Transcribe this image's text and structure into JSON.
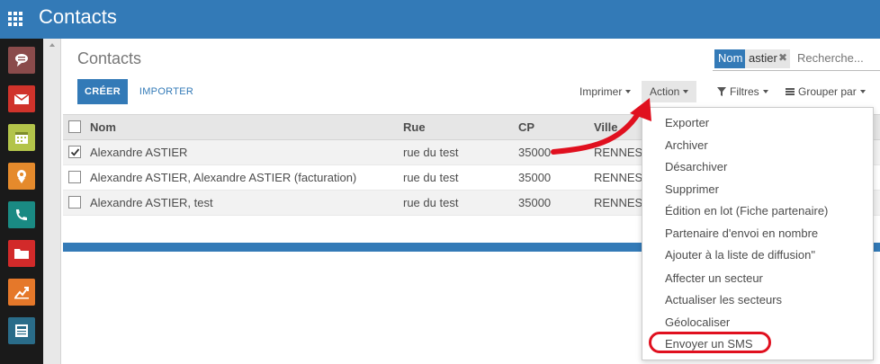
{
  "app": {
    "title": "Contacts"
  },
  "sidebar": {
    "apps": [
      {
        "icon": "chat-icon",
        "color": "#8a4b4b"
      },
      {
        "icon": "mail-icon",
        "color": "#d0332b"
      },
      {
        "icon": "calendar-icon",
        "color": "#b3c44a"
      },
      {
        "icon": "contacts-icon",
        "color": "#e58a2c"
      },
      {
        "icon": "phone-icon",
        "color": "#1a8a83"
      },
      {
        "icon": "folder-icon",
        "color": "#d22a2a"
      },
      {
        "icon": "chart-icon",
        "color": "#e5782a"
      },
      {
        "icon": "news-icon",
        "color": "#2a6c89"
      }
    ]
  },
  "breadcrumb": "Contacts",
  "search": {
    "facet_label": "Nom",
    "facet_value": "astier",
    "placeholder": "Recherche..."
  },
  "buttons": {
    "create": "CRÉER",
    "import": "IMPORTER"
  },
  "toolbar": {
    "print": "Imprimer",
    "action": "Action",
    "filters": "Filtres",
    "group_by": "Grouper par"
  },
  "table": {
    "columns": [
      "Nom",
      "Rue",
      "CP",
      "Ville"
    ],
    "rows": [
      {
        "checked": true,
        "name": "Alexandre ASTIER",
        "street": "rue du test",
        "zip": "35000",
        "city": "RENNES"
      },
      {
        "checked": false,
        "name": "Alexandre ASTIER, Alexandre ASTIER (facturation)",
        "street": "rue du test",
        "zip": "35000",
        "city": "RENNES"
      },
      {
        "checked": false,
        "name": "Alexandre ASTIER, test",
        "street": "rue du test",
        "zip": "35000",
        "city": "RENNES"
      }
    ]
  },
  "action_menu": {
    "items": [
      "Exporter",
      "Archiver",
      "Désarchiver",
      "Supprimer",
      "Édition en lot (Fiche partenaire)",
      "Partenaire d'envoi en nombre",
      "Ajouter à la liste de diffusion\"",
      "Affecter un secteur",
      "Actualiser les secteurs",
      "Géolocaliser",
      "Envoyer un SMS"
    ]
  },
  "colors": {
    "brand": "#337ab7",
    "annotation": "#e0101f"
  }
}
